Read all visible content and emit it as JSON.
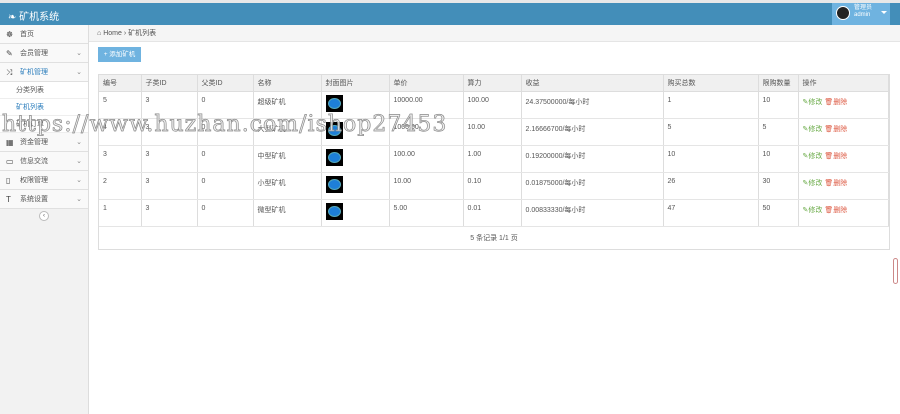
{
  "app": {
    "title": "矿机系统",
    "user_role": "管理员",
    "user_name": "admin"
  },
  "sidebar": {
    "items": [
      {
        "label": "首页",
        "icon": "dashboard-icon"
      },
      {
        "label": "会员管理",
        "icon": "edit-icon"
      },
      {
        "label": "矿机管理",
        "icon": "shuffle-icon",
        "sub": [
          "分类列表",
          "矿机列表",
          "矿机订单"
        ]
      },
      {
        "label": "资金管理",
        "icon": "calendar-icon"
      },
      {
        "label": "信息交流",
        "icon": "window-icon"
      },
      {
        "label": "权限管理",
        "icon": "file-icon"
      },
      {
        "label": "系统设置",
        "icon": "text-icon"
      }
    ]
  },
  "breadcrumb": {
    "home": "Home",
    "current": "矿机列表"
  },
  "add_button": "+ 添加矿机",
  "table": {
    "headers": [
      "编号",
      "子类ID",
      "父类ID",
      "名称",
      "封面图片",
      "单价",
      "算力",
      "收益",
      "购买总数",
      "限购数量",
      "操作"
    ],
    "rows": [
      [
        "5",
        "3",
        "0",
        "超级矿机",
        "",
        "10000.00",
        "100.00",
        "24.37500000/每小时",
        "1",
        "10"
      ],
      [
        "4",
        "3",
        "0",
        "大型矿机",
        "",
        "1000.00",
        "10.00",
        "2.16666700/每小时",
        "5",
        "5"
      ],
      [
        "3",
        "3",
        "0",
        "中型矿机",
        "",
        "100.00",
        "1.00",
        "0.19200000/每小时",
        "10",
        "10"
      ],
      [
        "2",
        "3",
        "0",
        "小型矿机",
        "",
        "10.00",
        "0.10",
        "0.01875000/每小时",
        "26",
        "30"
      ],
      [
        "1",
        "3",
        "0",
        "微型矿机",
        "",
        "5.00",
        "0.01",
        "0.00833330/每小时",
        "47",
        "50"
      ]
    ],
    "edit": "修改",
    "delete": "删除"
  },
  "pager": "5 条记录 1/1 页",
  "watermark": "https://www.huzhan.com/ishop27453"
}
